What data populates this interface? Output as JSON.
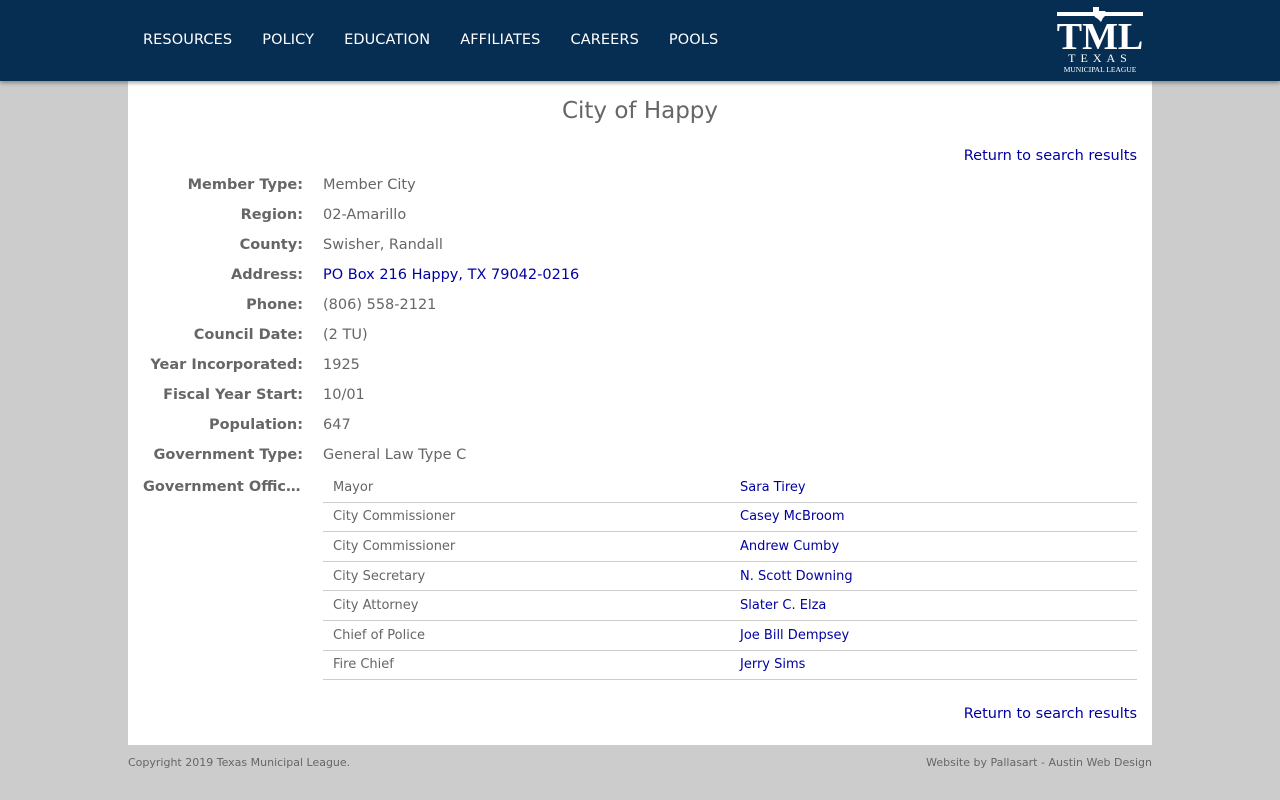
{
  "nav": [
    "RESOURCES",
    "POLICY",
    "EDUCATION",
    "AFFILIATES",
    "CAREERS",
    "POOLS"
  ],
  "logo": {
    "main": "TML",
    "line1": "TEXAS",
    "line2": "MUNICIPAL LEAGUE"
  },
  "page": {
    "title": "City of Happy",
    "return_link": "Return to search results"
  },
  "fields": [
    {
      "label": "Member Type:",
      "value": "Member City"
    },
    {
      "label": "Region:",
      "value": "02-Amarillo"
    },
    {
      "label": "County:",
      "value": "Swisher, Randall"
    },
    {
      "label": "Address:",
      "value": "PO Box 216 Happy, TX 79042-0216"
    },
    {
      "label": "Phone:",
      "value": "(806) 558-2121"
    },
    {
      "label": "Council Date:",
      "value": "(2 TU)"
    },
    {
      "label": "Year Incorporated:",
      "value": "1925"
    },
    {
      "label": "Fiscal Year Start:",
      "value": "10/01"
    },
    {
      "label": "Population:",
      "value": "647"
    },
    {
      "label": "Government Type:",
      "value": "General Law Type C"
    }
  ],
  "officials_label": "Government Offici...",
  "officials": [
    {
      "role": "Mayor",
      "name": "Sara Tirey"
    },
    {
      "role": "City Commissioner",
      "name": "Casey McBroom"
    },
    {
      "role": "City Commissioner",
      "name": "Andrew Cumby"
    },
    {
      "role": "City Secretary",
      "name": "N. Scott Downing"
    },
    {
      "role": "City Attorney",
      "name": "Slater C. Elza"
    },
    {
      "role": "Chief of Police",
      "name": "Joe Bill Dempsey"
    },
    {
      "role": "Fire Chief",
      "name": "Jerry Sims"
    }
  ],
  "footer": {
    "copyright": "Copyright 2019 Texas Municipal League.",
    "credit": "Website by Pallasart - Austin Web Design"
  }
}
